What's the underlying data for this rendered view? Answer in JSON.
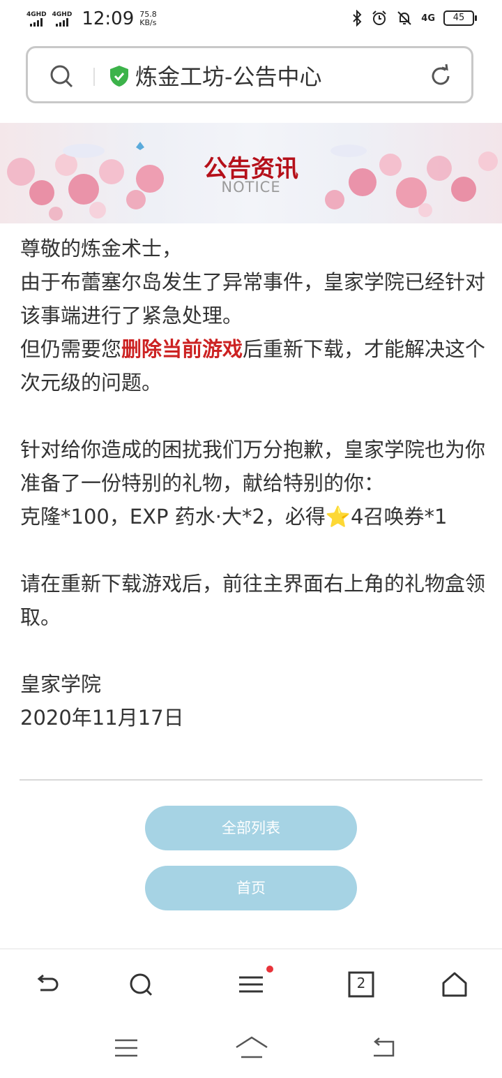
{
  "status_bar": {
    "sim1": "4GHD",
    "sim2": "4GHD",
    "time": "12:09",
    "speed_value": "75.8",
    "speed_unit": "KB/s",
    "network": "4G",
    "battery": "45"
  },
  "address_bar": {
    "title": "炼金工坊-公告中心"
  },
  "banner": {
    "title": "公告资讯",
    "subtitle": "NOTICE"
  },
  "article": {
    "greeting": "尊敬的炼金术士，",
    "para1": "由于布蕾塞尔岛发生了异常事件，皇家学院已经针对该事端进行了紧急处理。",
    "para2_before": "但仍需要您",
    "para2_highlight": "删除当前游戏",
    "para2_after": "后重新下载，才能解决这个次元级的问题。",
    "para3": "针对给你造成的困扰我们万分抱歉，皇家学院也为你准备了一份特别的礼物，献给特别的你：",
    "rewards_before": "克隆*100，EXP 药水·大*2，必得",
    "rewards_star": "⭐",
    "rewards_after": "4召唤券*1",
    "para4": "请在重新下载游戏后，前往主界面右上角的礼物盒领取。",
    "signature": "皇家学院",
    "date": "2020年11月17日"
  },
  "buttons": {
    "all_list": "全部列表",
    "home": "首页"
  },
  "toolbar": {
    "tab_count": "2"
  },
  "colors": {
    "accent_button": "#a6d3e4",
    "highlight": "#cc2222",
    "banner_title": "#b5101a"
  }
}
